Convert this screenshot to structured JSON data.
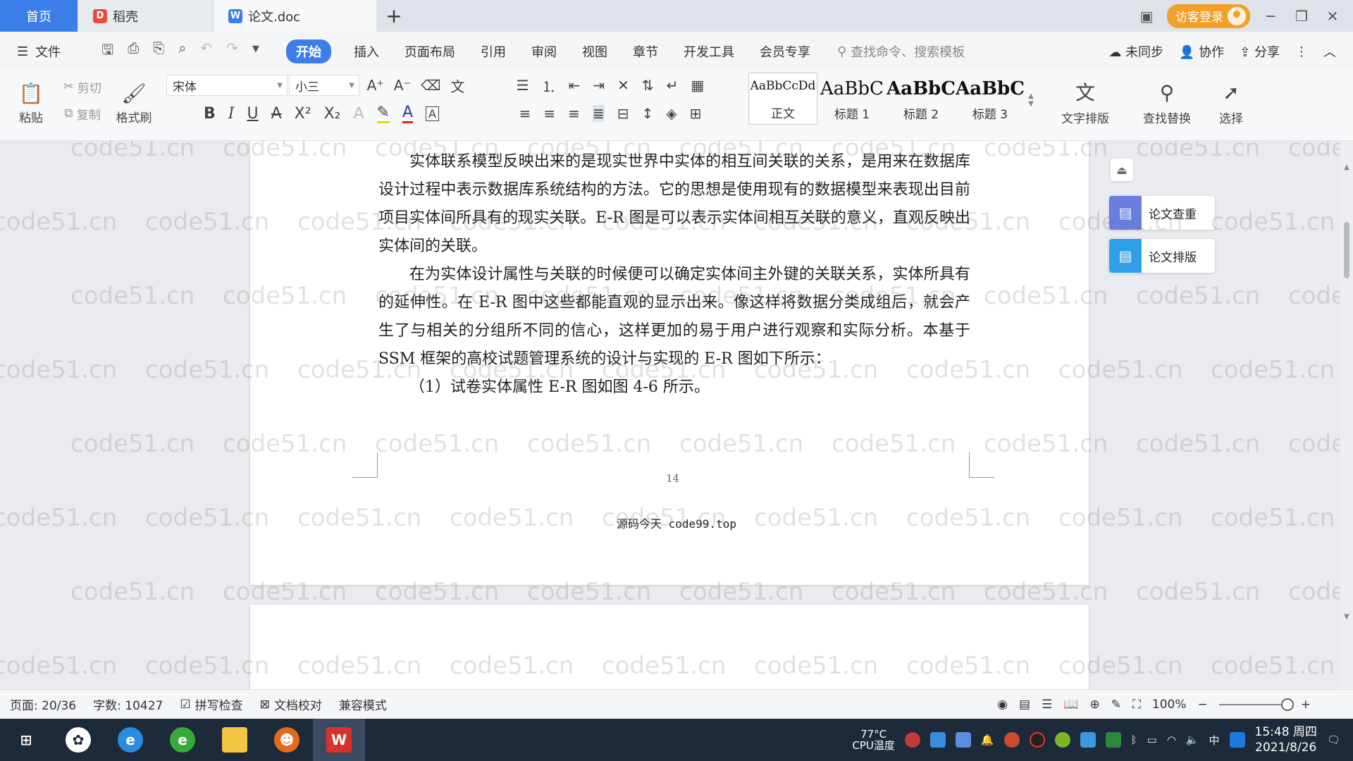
{
  "tabs": {
    "home": "首页",
    "daoke": "稻壳",
    "doc": "论文.doc",
    "add": "+"
  },
  "title_right": {
    "login": "访客登录"
  },
  "menu": {
    "file": "文件",
    "items": [
      "开始",
      "插入",
      "页面布局",
      "引用",
      "审阅",
      "视图",
      "章节",
      "开发工具",
      "会员专享"
    ],
    "search_placeholder": "查找命令、搜索模板",
    "unsynced": "未同步",
    "collab": "协作",
    "share": "分享"
  },
  "ribbon": {
    "paste": "粘贴",
    "cut": "剪切",
    "copy": "复制",
    "format_painter": "格式刷",
    "font_name": "宋体",
    "font_size": "小三",
    "styles": [
      {
        "sample": "AaBbCcDd",
        "name": "正文"
      },
      {
        "sample": "AaBbC",
        "name": "标题 1"
      },
      {
        "sample": "AaBbC",
        "name": "标题 2"
      },
      {
        "sample": "AaBbC",
        "name": "标题 3"
      }
    ],
    "text_layout": "文字排版",
    "find_replace": "查找替换",
    "select": "选择"
  },
  "document": {
    "paragraphs": [
      "实体联系模型反映出来的是现实世界中实体的相互间关联的关系，是用来在数据库设计过程中表示数据库系统结构的方法。它的思想是使用现有的数据模型来表现出目前项目实体间所具有的现实关联。E-R 图是可以表示实体间相互关联的意义，直观反映出实体间的关联。",
      "在为实体设计属性与关联的时候便可以确定实体间主外键的关联关系，实体所具有的延伸性。在 E-R 图中这些都能直观的显示出来。像这样将数据分类成组后，就会产生了与相关的分组所不同的信心，这样更加的易于用户进行观察和实际分析。本基于 SSM 框架的高校试题管理系统的设计与实现的 E-R 图如下所示："
    ],
    "caption": "（1）试卷实体属性 E-R 图如图 4-6 所示。",
    "overlay": "源码今天 code99.top",
    "page_number": "14",
    "watermark": "code51.cn"
  },
  "side_panel": {
    "check": "论文查重",
    "layout": "论文排版"
  },
  "status": {
    "page": "页面: 20/36",
    "words": "字数: 10427",
    "spell": "拼写检查",
    "proof": "文档校对",
    "compat": "兼容模式",
    "zoom": "100%",
    "zoom_level": 1.0
  },
  "taskbar": {
    "cpu_temp": "77°C",
    "cpu_label": "CPU温度",
    "ime": "中",
    "time": "15:48 周四",
    "date": "2021/8/26"
  },
  "colors": {
    "accent": "#3c7ee8",
    "login": "#f1a02a",
    "taskbar": "#1d2a3a"
  }
}
